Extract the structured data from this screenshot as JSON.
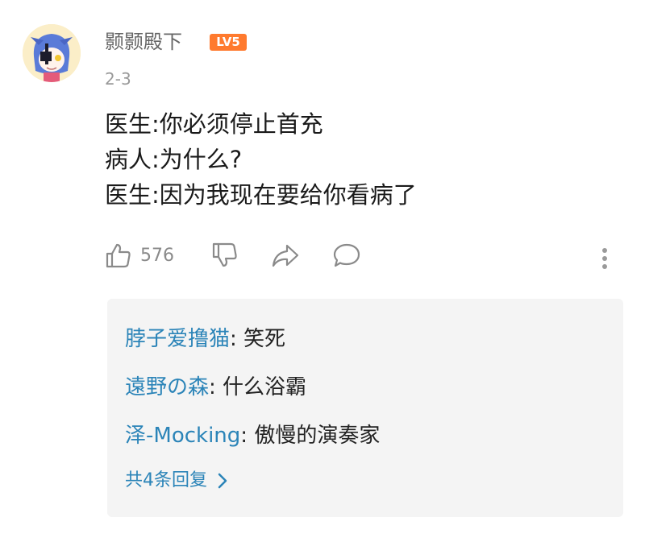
{
  "comment": {
    "username": "颢颢殿下",
    "level_badge": "LV5",
    "date": "2-3",
    "lines": [
      "医生:你必须停止首充",
      "病人:为什么?",
      "医生:因为我现在要给你看病了"
    ]
  },
  "actions": {
    "like_count": "576",
    "icons": [
      "thumbs-up-icon",
      "thumbs-down-icon",
      "share-icon",
      "reply-bubble-icon",
      "more-vertical-icon"
    ]
  },
  "replies": {
    "items": [
      {
        "name": "脖子爱撸猫",
        "separator": ": ",
        "text": "笑死"
      },
      {
        "name": "遠野の森",
        "separator": ": ",
        "text": "什么浴霸"
      },
      {
        "name": "泽-Mocking",
        "separator": ": ",
        "text": "傲慢的演奏家"
      }
    ],
    "more_label": "共4条回复"
  },
  "colors": {
    "link_blue": "#2b84b8",
    "badge_orange": "#ff7a2e",
    "panel_bg": "#f4f4f4"
  }
}
